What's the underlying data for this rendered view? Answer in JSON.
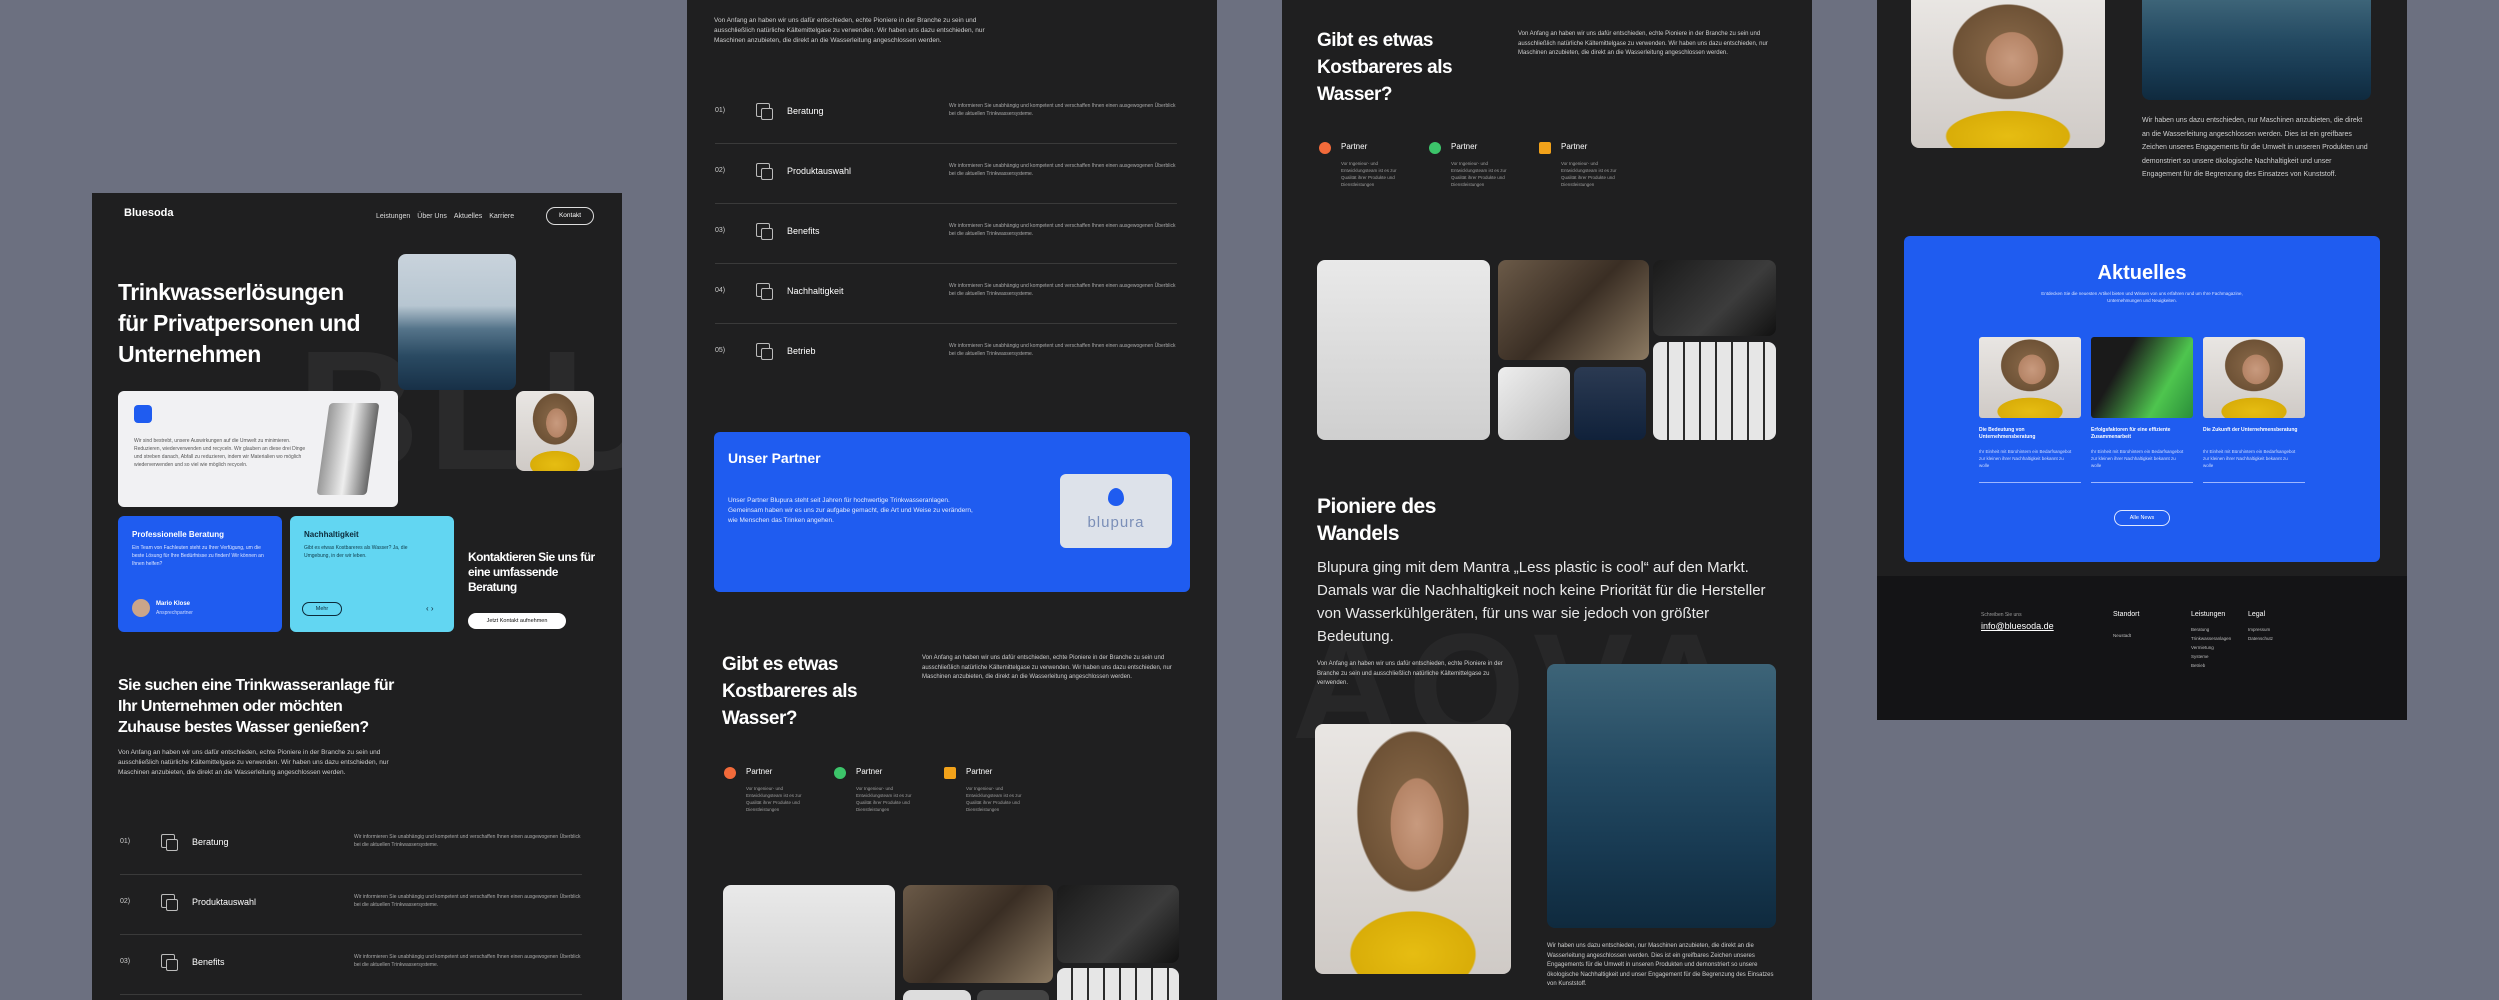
{
  "brand": {
    "name": "Bluesoda"
  },
  "nav": {
    "items": [
      "Leistungen",
      "Über Uns",
      "Aktuelles",
      "Karriere"
    ],
    "contact": "Kontakt"
  },
  "hero": {
    "title": "Trinkwasserlösungen für Privatpersonen und Unternehmen",
    "card_text": "Wir sind bestrebt, unsere Auswirkungen auf die Umwelt zu minimieren. Reduzieren, wiederverwenden und recyceln. Wir glauben an diese drei Dinge und streben danach, Abfall zu reduzieren, indem wir Materialien wo möglich wiederverwenden und so viel wie möglich recyceln.",
    "advice_title": "Professionelle Beratung",
    "advice_text": "Ein Team von Fachleuten steht zu Ihrer Verfügung, um die beste Lösung für Ihre Bedürfnisse zu finden! Wir können an Ihnen helfen?",
    "person_name": "Mario Klose",
    "person_role": "Ansprechpartner",
    "sustain_title": "Nachhaltigkeit",
    "sustain_text": "Gibt es etwas Kostbareres als Wasser? Ja, die Umgebung, in der wir leben.",
    "more": "Mehr",
    "contact_title": "Kontaktieren Sie uns für eine umfassende Beratung",
    "contact_btn": "Jetzt Kontakt aufnehmen",
    "watermark": "BLUE"
  },
  "intro": {
    "title": "Sie suchen eine Trinkwasseranlage für Ihr Unternehmen oder möchten Zuhause bestes Wasser genießen?",
    "text": "Von Anfang an haben wir uns dafür entschieden, echte Pioniere in der Branche zu sein und ausschließlich natürliche Kältemittelgase zu verwenden. Wir haben uns dazu entschieden, nur Maschinen anzubieten, die direkt an die Wasserleitung angeschlossen werden."
  },
  "services": {
    "items": [
      {
        "num": "01)",
        "label": "Beratung"
      },
      {
        "num": "02)",
        "label": "Produktauswahl"
      },
      {
        "num": "03)",
        "label": "Benefits"
      },
      {
        "num": "04)",
        "label": "Nachhaltigkeit"
      },
      {
        "num": "05)",
        "label": "Betrieb"
      }
    ],
    "desc": "Wir informieren Sie unabhängig und kompetent und verschaffen Ihnen einen ausgewogenen Überblick bei die aktuellen Trinkwassersysteme."
  },
  "partner": {
    "title": "Unser Partner",
    "text": "Unser Partner Blupura steht seit Jahren für hochwertige Trinkwasseranlagen. Gemeinsam haben wir es uns zur aufgabe gemacht, die Art und Weise zu verändern, wie Menschen das Trinken angehen.",
    "logo": "blupura"
  },
  "precious": {
    "title": "Gibt es etwas Kostbareres als Wasser?",
    "text": "Von Anfang an haben wir uns dafür entschieden, echte Pioniere in der Branche zu sein und ausschließlich natürliche Kältemittelgase zu verwenden. Wir haben uns dazu entschieden, nur Maschinen anzubieten, die direkt an die Wasserleitung angeschlossen werden.",
    "partners": [
      {
        "label": "Partner",
        "text": "Vor Ingenieur- und Entwicklungsteam ist es zur Qualität ihrer Produkte und Dienstleistungen",
        "color": "#f26a3a"
      },
      {
        "label": "Partner",
        "text": "Vor Ingenieur- und Entwicklungsteam ist es zur Qualität ihrer Produkte und Dienstleistungen",
        "color": "#3cc46a"
      },
      {
        "label": "Partner",
        "text": "Vor Ingenieur- und Entwicklungsteam ist es zur Qualität ihrer Produkte und Dienstleistungen",
        "color": "#f2a21a"
      }
    ]
  },
  "pioneer": {
    "title": "Pioniere des Wandels",
    "lead": "Blupura ging mit dem Mantra „Less plastic is cool“ auf den Markt. Damals war die Nachhaltigkeit noch keine Priorität für die Hersteller von Wasserkühlgeräten, für uns war sie jedoch von größter Bedeutung.",
    "text": "Von Anfang an haben wir uns dafür entschieden, echte Pioniere in der Branche zu sein und ausschließlich natürliche Kältemittelgase zu verwenden.",
    "text2": "Wir haben uns dazu entschieden, nur Maschinen anzubieten, die direkt an die Wasserleitung angeschlossen werden. Dies ist ein greifbares Zeichen unseres Engagements für die Umwelt in unseren Produkten und demonstriert so unsere ökologische Nachhaltigkeit und unser Engagement für die Begrenzung des Einsatzes von Kunststoff.",
    "watermark": "AQVA"
  },
  "news": {
    "title": "Aktuelles",
    "sub": "Entdecken Sie die neuesten Artikel bieten und Wissen von uns erfahren rund um Ihre Fachmagazine, Unternehmungen und Neuigkeiten.",
    "items": [
      {
        "title": "Die Bedeutung von Unternehmensberatung",
        "text": "Ihr Einheit mit Bürohintern ein Bedarfsangebot zur kleinen ihrer Nachhaltigkeit bekannt zu wolle"
      },
      {
        "title": "Erfolgsfaktoren für eine effiziente Zusammenarbeit",
        "text": "Ihr Einheit mit Bürohintern ein Bedarfsangebot zur kleinen ihrer Nachhaltigkeit bekannt zu wolle"
      },
      {
        "title": "Die Zukunft der Unternehmensberatung",
        "text": "Ihr Einheit mit Bürohintern ein Bedarfsangebot zur kleinen ihrer Nachhaltigkeit bekannt zu wolle"
      }
    ],
    "all": "Alle News"
  },
  "footer": {
    "write": "Schreiben Sie uns",
    "email": "info@bluesoda.de",
    "cols": [
      {
        "title": "Standort",
        "items": [
          "Neustadt"
        ]
      },
      {
        "title": "Leistungen",
        "items": [
          "Beratung",
          "Trinkwasseranlagen",
          "Vermietung",
          "Systeme",
          "Betrieb"
        ]
      },
      {
        "title": "Legal",
        "items": [
          "Impressum",
          "Datenschutz"
        ]
      }
    ]
  }
}
